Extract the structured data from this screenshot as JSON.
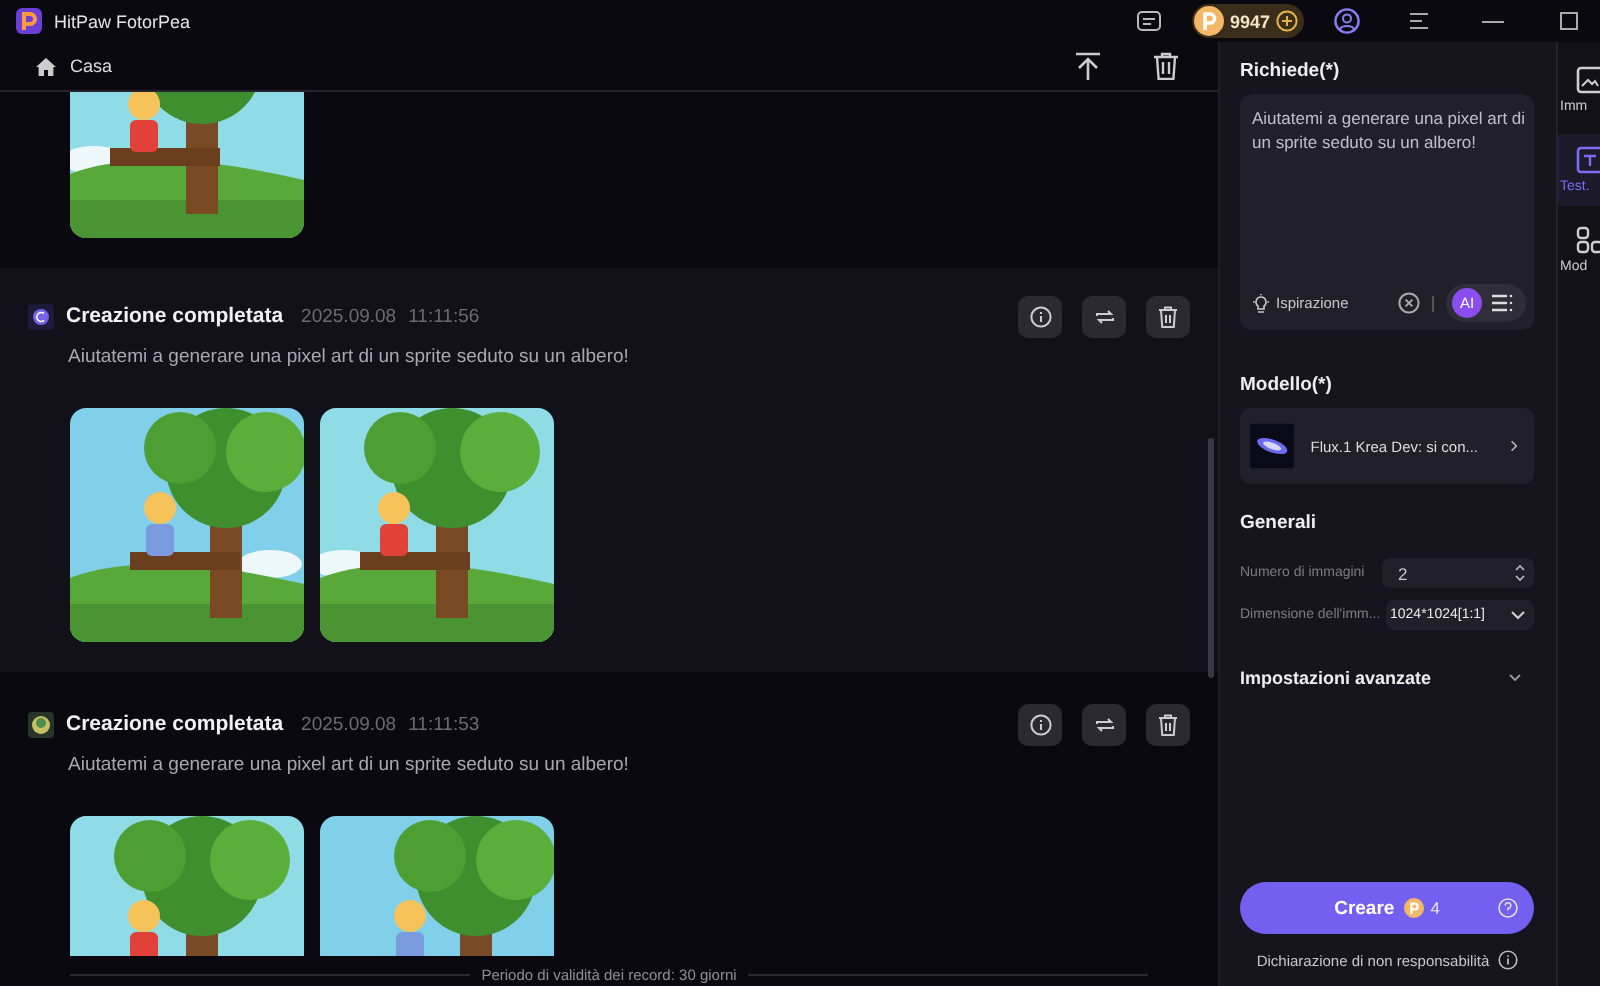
{
  "app": {
    "title": "HitPaw FotorPea",
    "credits": "9947"
  },
  "breadcrumb": {
    "label": "Casa"
  },
  "records": [
    {
      "selected": false
    },
    {
      "selected": true,
      "status": "Creazione completata",
      "date": "2025.09.08",
      "time": "11:11:56",
      "prompt": "Aiutatemi a generare una pixel art di un sprite seduto su un albero!"
    },
    {
      "selected": false,
      "status": "Creazione completata",
      "date": "2025.09.08",
      "time": "11:11:53",
      "prompt": "Aiutatemi a generare una pixel art di un sprite seduto su un albero!"
    }
  ],
  "footer": "Periodo di validità dei record: 30 giorni",
  "panel": {
    "prompt": {
      "label": "Richiede(*)",
      "value": "Aiutatemi a generare una pixel art di un sprite seduto su un albero!",
      "inspiration": "Ispirazione",
      "ai": "AI"
    },
    "model": {
      "label": "Modello(*)",
      "name": "Flux.1 Krea Dev: si con..."
    },
    "general": {
      "title": "Generali",
      "fields": [
        {
          "kind": "stepper",
          "label": "Numero di immagini",
          "value": "2"
        },
        {
          "kind": "select",
          "label": "Dimensione dell'imm...",
          "value": "1024*1024[1:1]"
        }
      ]
    },
    "advanced": {
      "label": "Impostazioni avanzate",
      "expanded": false
    },
    "create": {
      "label": "Creare",
      "cost": "4"
    },
    "disclaimer": "Dichiarazione di non responsabilità"
  },
  "side_tabs": [
    {
      "label": "Imm",
      "selected": false
    },
    {
      "label": "Test.",
      "selected": true
    },
    {
      "label": "Mod",
      "selected": false
    }
  ]
}
